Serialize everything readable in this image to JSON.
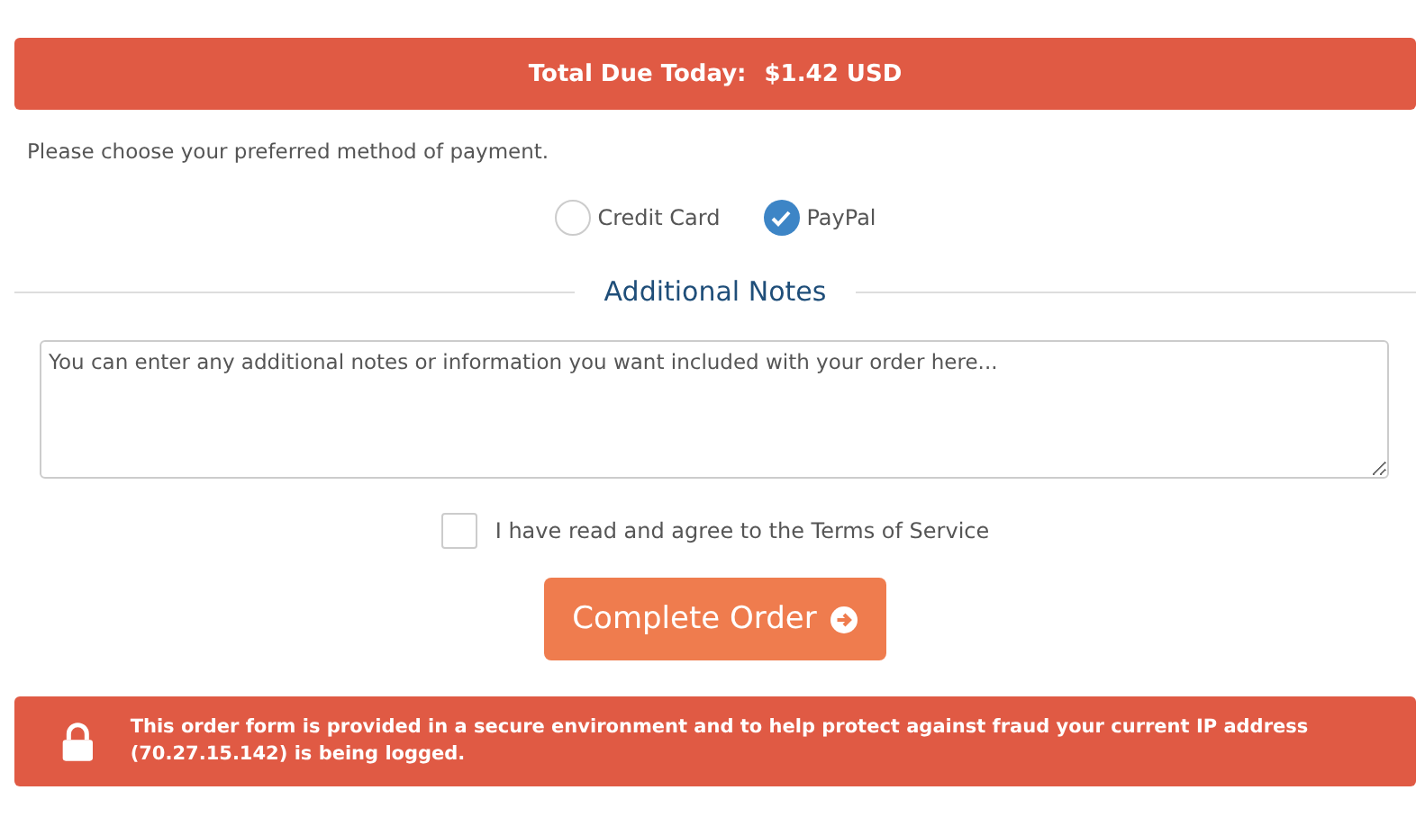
{
  "total": {
    "label": "Total Due Today:",
    "amount": "$1.42 USD"
  },
  "payment_prompt": "Please choose your preferred method of payment.",
  "payment_methods": [
    {
      "label": "Credit Card",
      "selected": false
    },
    {
      "label": "PayPal",
      "selected": true
    }
  ],
  "notes": {
    "heading": "Additional Notes",
    "placeholder": "You can enter any additional notes or information you want included with your order here..."
  },
  "terms": {
    "label": "I have read and agree to the Terms of Service",
    "checked": false
  },
  "submit_button": "Complete Order",
  "security_notice": "This order form is provided in a secure environment and to help protect against fraud your current IP address (**70.27.15.142**) is being logged."
}
